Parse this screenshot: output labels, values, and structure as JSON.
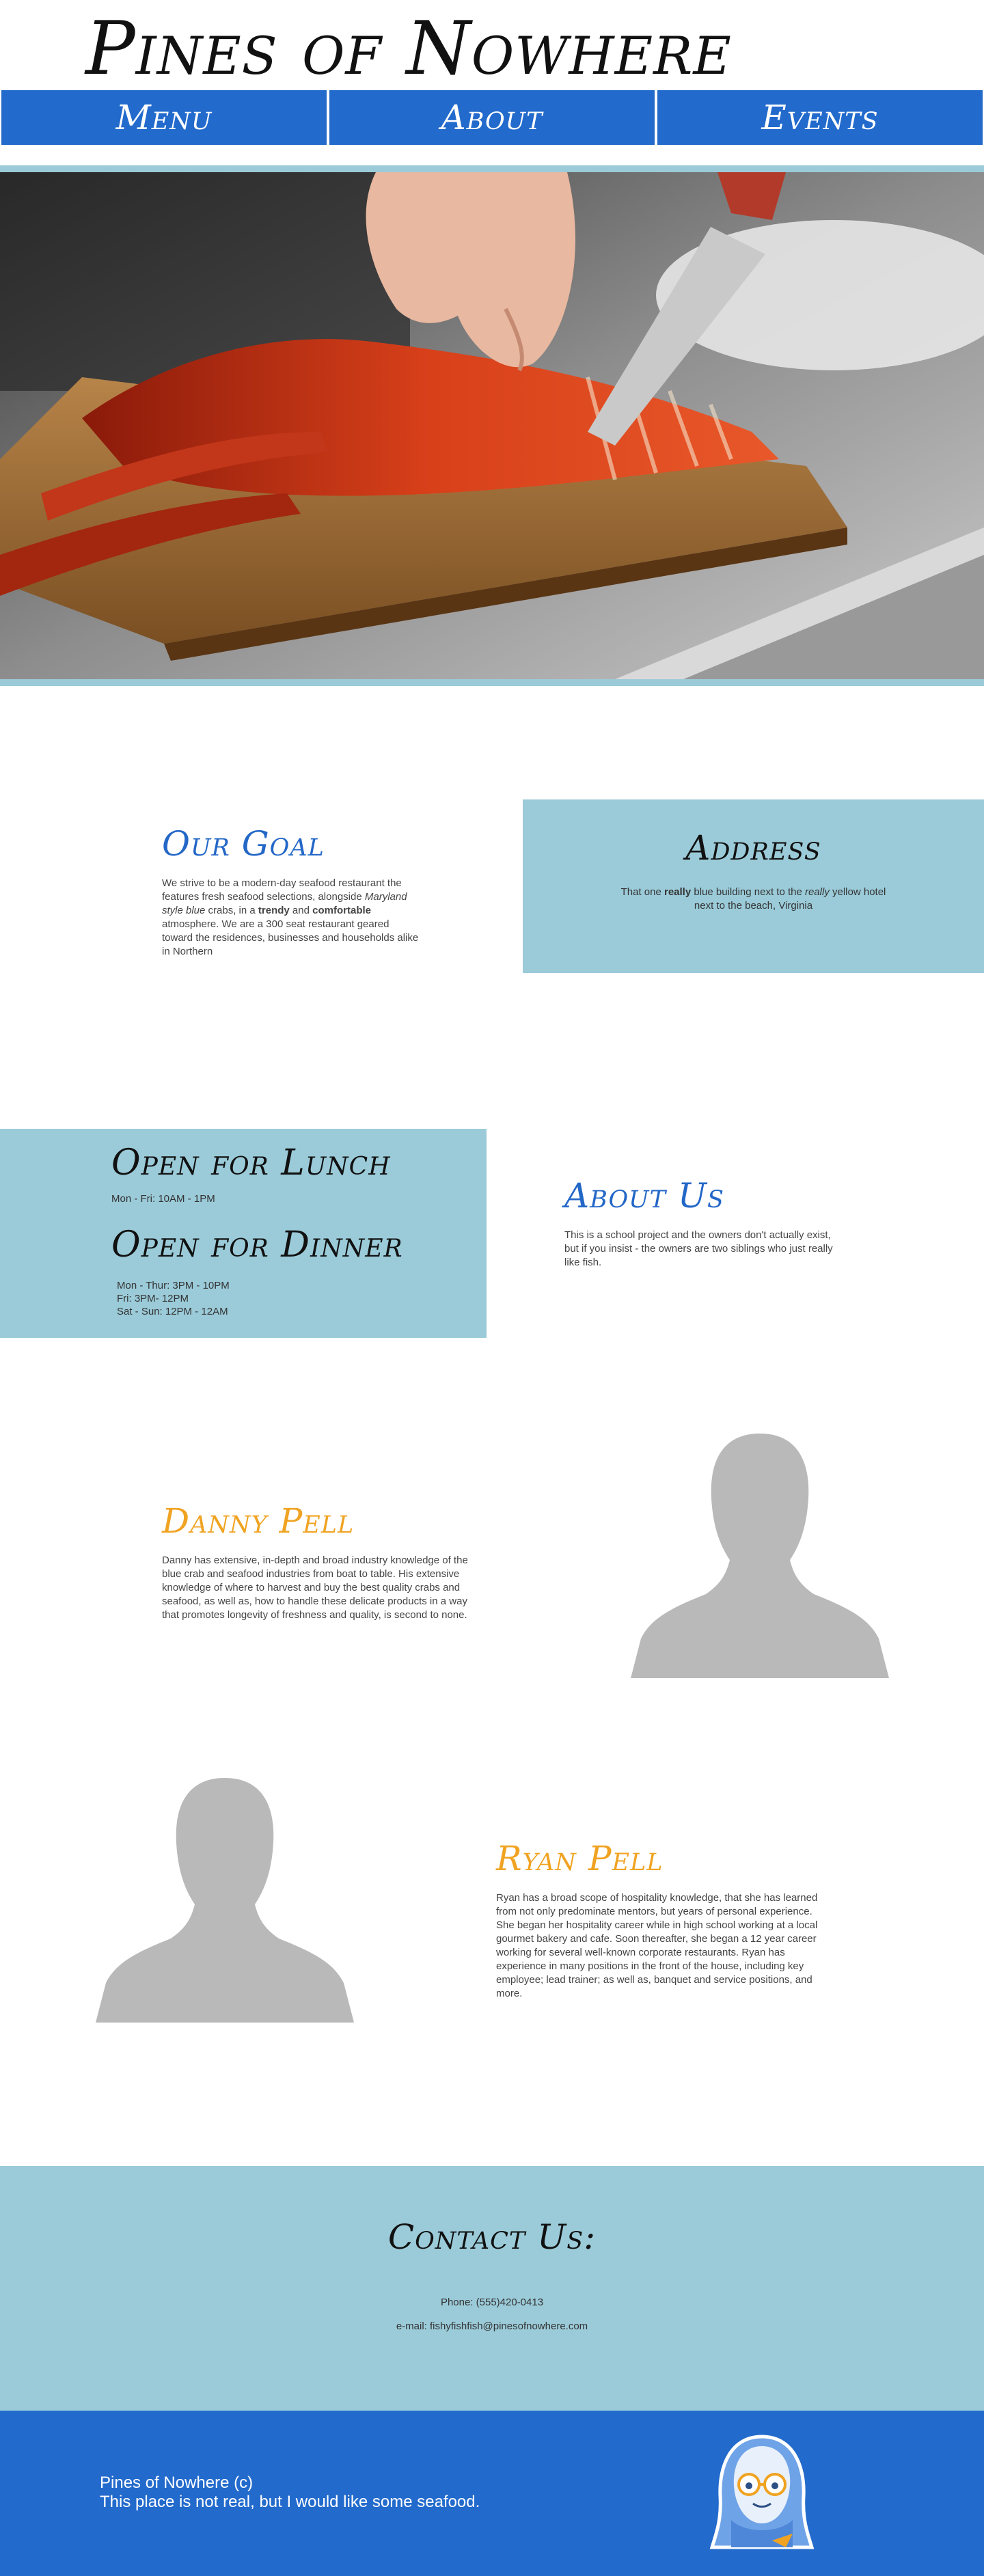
{
  "header": {
    "title": "Pines of Nowhere",
    "nav": [
      {
        "label": "Menu"
      },
      {
        "label": "About"
      },
      {
        "label": "Events"
      }
    ]
  },
  "goal": {
    "title": "Our Goal",
    "text_1": "We strive to be a modern-day seafood restaurant the features fresh seafood selections, alongside ",
    "text_2": "Maryland style blue",
    "text_3": " crabs, in a ",
    "text_4": "trendy",
    "text_5": " and ",
    "text_6": "comfortable",
    "text_7": " atmosphere. We are a 300 seat restaurant geared toward the residences, businesses and households alike in Northern"
  },
  "address": {
    "title": "Address",
    "text_1": "That one ",
    "text_2": "really",
    "text_3": " blue building next to the ",
    "text_4": "really",
    "text_5": " yellow hotel next to the beach, Virginia"
  },
  "hours": {
    "lunch_title": "Open for Lunch",
    "lunch_hours": "Mon - Fri: 10AM - 1PM",
    "dinner_title": "Open for Dinner",
    "dinner_hours": [
      "Mon - Thur: 3PM - 10PM",
      "Fri: 3PM- 12PM",
      "Sat - Sun: 12PM - 12AM"
    ]
  },
  "about": {
    "title": "About Us",
    "text": "This is a school project and the owners don't actually exist, but if you insist - the owners are two siblings who just really like fish."
  },
  "people": {
    "danny": {
      "name": "Danny Pell",
      "bio": "Danny has extensive, in-depth and broad industry knowledge of the blue crab and seafood industries from boat to table. His extensive knowledge of where to harvest and buy the best quality crabs and seafood, as well as, how to handle these delicate products in a way that promotes longevity of freshness and quality, is second to none."
    },
    "ryan": {
      "name": "Ryan Pell",
      "bio": "Ryan has a broad scope of hospitality knowledge, that she has learned from not only predominate mentors, but years of personal experience. She began her hospitality career while in high school working at a local gourmet bakery and cafe. Soon thereafter, she began a 12 year career working for several well-known corporate restaurants. Ryan has experience in many positions in the front of the house, including key employee; lead trainer; as well as, banquet and service positions, and more."
    }
  },
  "contact": {
    "title": "Contact Us:",
    "phone": "Phone: (555)420-0413",
    "email": "e-mail: fishyfishfish@pinesofnowhere.com"
  },
  "footer": {
    "copyright": "Pines of Nowhere (c)",
    "tagline": "This place is not real, but I would like some seafood."
  },
  "colors": {
    "brand_blue": "#226acc",
    "light_blue": "#9bcbd9",
    "accent_orange": "#f0a322",
    "title_blue": "#2367c7"
  }
}
